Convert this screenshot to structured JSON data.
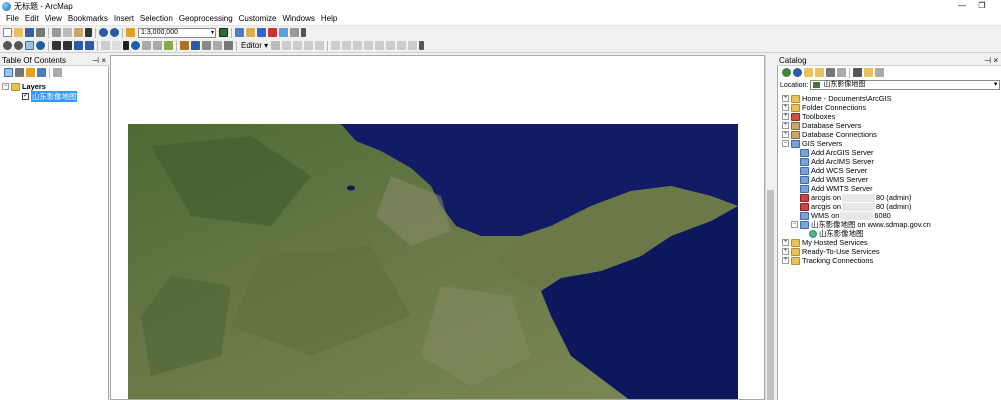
{
  "window": {
    "title": "无标题 - ArcMap",
    "controls": [
      "—",
      "❐"
    ]
  },
  "menu": [
    "File",
    "Edit",
    "View",
    "Bookmarks",
    "Insert",
    "Selection",
    "Geoprocessing",
    "Customize",
    "Windows",
    "Help"
  ],
  "toolbar": {
    "scale_value": "1:3,000,000",
    "editor_label": "Editor ▾"
  },
  "toc": {
    "title": "Table Of Contents",
    "pin": "⊣ ×",
    "layers_label": "Layers",
    "layer_name": "山东影像地图",
    "layer_checked": true
  },
  "catalog": {
    "title": "Catalog",
    "pin": "⊣ ×",
    "location_label": "Location:",
    "location_value": "山东影像地图",
    "items": [
      {
        "label": "Home - Documents\\ArcGIS",
        "icon": "home-folder-icon"
      },
      {
        "label": "Folder Connections",
        "icon": "folder-icon"
      },
      {
        "label": "Toolboxes",
        "icon": "toolbox-icon"
      },
      {
        "label": "Database Servers",
        "icon": "database-server-icon"
      },
      {
        "label": "Database Connections",
        "icon": "database-icon"
      },
      {
        "label": "GIS Servers",
        "icon": "server-icon"
      },
      {
        "label": "Add ArcGIS Server",
        "icon": "add-server-icon"
      },
      {
        "label": "Add ArcIMS Server",
        "icon": "add-server-icon"
      },
      {
        "label": "Add WCS Server",
        "icon": "add-server-icon"
      },
      {
        "label": "Add WMS Server",
        "icon": "add-server-icon"
      },
      {
        "label": "Add WMTS Server",
        "icon": "add-server-icon"
      },
      {
        "label": "arcgis on",
        "suffix": "80 (admin)",
        "icon": "server-icon"
      },
      {
        "label": "arcgis on",
        "suffix": "80 (admin)",
        "icon": "server-icon"
      },
      {
        "label": "WMS on",
        "suffix": "6080",
        "icon": "server-icon"
      },
      {
        "label": "山东影像地图 on www.sdmap.gov.cn",
        "icon": "wms-service-icon"
      },
      {
        "label": "山东影像地图",
        "icon": "map-layer-icon"
      },
      {
        "label": "My Hosted Services",
        "icon": "folder-icon"
      },
      {
        "label": "Ready-To-Use Services",
        "icon": "folder-icon"
      },
      {
        "label": "Tracking Connections",
        "icon": "folder-icon"
      }
    ]
  },
  "colors": {
    "selection": "#3399ff",
    "sea": "#0e1a6a"
  }
}
